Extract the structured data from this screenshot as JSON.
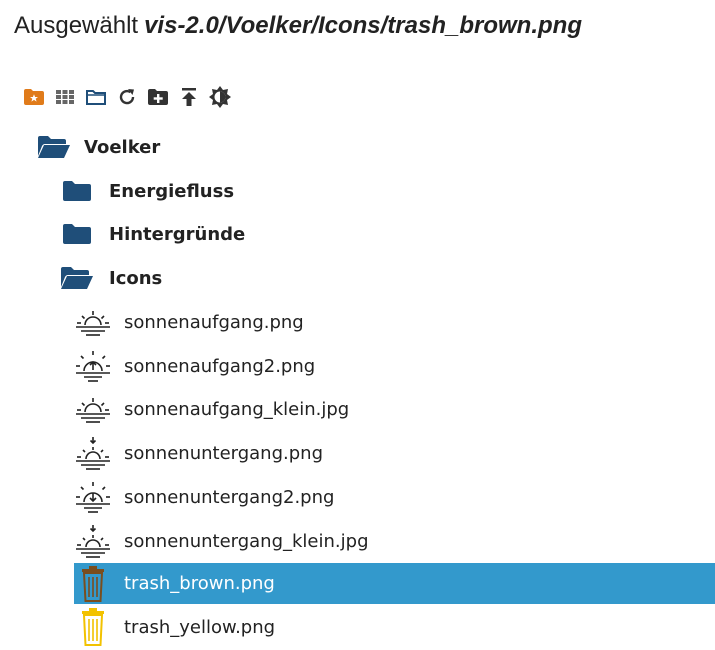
{
  "header": {
    "prefix": "Ausgewählt",
    "selected_path": "vis-2.0/Voelker/Icons/trash_brown.png"
  },
  "toolbar": {
    "icons": [
      "favorite-folder-icon",
      "grid-view-icon",
      "folder-view-icon",
      "refresh-icon",
      "new-folder-icon",
      "upload-icon",
      "brightness-icon"
    ],
    "colors": {
      "favorite": "#e07b1a",
      "dark": "#333333"
    }
  },
  "tree": {
    "root": {
      "label": "Voelker",
      "icon": "folder-open-icon"
    },
    "folders": [
      {
        "label": "Energiefluss",
        "icon": "folder-closed-icon"
      },
      {
        "label": "Hintergründe",
        "icon": "folder-closed-icon"
      },
      {
        "label": "Icons",
        "icon": "folder-open-icon"
      }
    ],
    "files": [
      {
        "label": "sonnenaufgang.png",
        "icon": "sunrise-icon"
      },
      {
        "label": "sonnenaufgang2.png",
        "icon": "sunrise-arrow-icon"
      },
      {
        "label": "sonnenaufgang_klein.jpg",
        "icon": "sunrise-icon"
      },
      {
        "label": "sonnenuntergang.png",
        "icon": "sunset-icon"
      },
      {
        "label": "sonnenuntergang2.png",
        "icon": "sunset-arrow-icon"
      },
      {
        "label": "sonnenuntergang_klein.jpg",
        "icon": "sunset-icon"
      },
      {
        "label": "trash_brown.png",
        "icon": "trash-brown-icon",
        "selected": true
      },
      {
        "label": "trash_yellow.png",
        "icon": "trash-yellow-icon"
      }
    ],
    "colors": {
      "folder": "#1f4e79",
      "selection": "#3399cc",
      "trash_brown": "#7a4e1e",
      "trash_yellow": "#f2c200"
    }
  }
}
